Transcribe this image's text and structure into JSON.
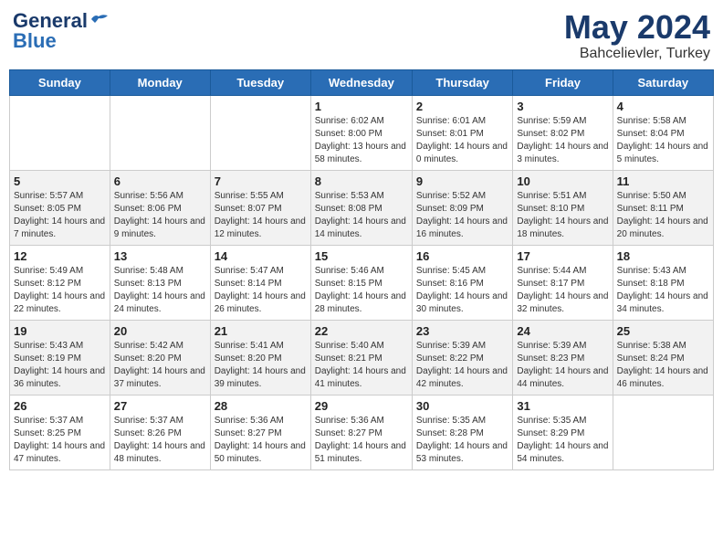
{
  "header": {
    "logo_general": "General",
    "logo_blue": "Blue",
    "month": "May 2024",
    "location": "Bahcelievler, Turkey"
  },
  "weekdays": [
    "Sunday",
    "Monday",
    "Tuesday",
    "Wednesday",
    "Thursday",
    "Friday",
    "Saturday"
  ],
  "weeks": [
    [
      {
        "day": "",
        "sunrise": "",
        "sunset": "",
        "daylight": ""
      },
      {
        "day": "",
        "sunrise": "",
        "sunset": "",
        "daylight": ""
      },
      {
        "day": "",
        "sunrise": "",
        "sunset": "",
        "daylight": ""
      },
      {
        "day": "1",
        "sunrise": "Sunrise: 6:02 AM",
        "sunset": "Sunset: 8:00 PM",
        "daylight": "Daylight: 13 hours and 58 minutes."
      },
      {
        "day": "2",
        "sunrise": "Sunrise: 6:01 AM",
        "sunset": "Sunset: 8:01 PM",
        "daylight": "Daylight: 14 hours and 0 minutes."
      },
      {
        "day": "3",
        "sunrise": "Sunrise: 5:59 AM",
        "sunset": "Sunset: 8:02 PM",
        "daylight": "Daylight: 14 hours and 3 minutes."
      },
      {
        "day": "4",
        "sunrise": "Sunrise: 5:58 AM",
        "sunset": "Sunset: 8:04 PM",
        "daylight": "Daylight: 14 hours and 5 minutes."
      }
    ],
    [
      {
        "day": "5",
        "sunrise": "Sunrise: 5:57 AM",
        "sunset": "Sunset: 8:05 PM",
        "daylight": "Daylight: 14 hours and 7 minutes."
      },
      {
        "day": "6",
        "sunrise": "Sunrise: 5:56 AM",
        "sunset": "Sunset: 8:06 PM",
        "daylight": "Daylight: 14 hours and 9 minutes."
      },
      {
        "day": "7",
        "sunrise": "Sunrise: 5:55 AM",
        "sunset": "Sunset: 8:07 PM",
        "daylight": "Daylight: 14 hours and 12 minutes."
      },
      {
        "day": "8",
        "sunrise": "Sunrise: 5:53 AM",
        "sunset": "Sunset: 8:08 PM",
        "daylight": "Daylight: 14 hours and 14 minutes."
      },
      {
        "day": "9",
        "sunrise": "Sunrise: 5:52 AM",
        "sunset": "Sunset: 8:09 PM",
        "daylight": "Daylight: 14 hours and 16 minutes."
      },
      {
        "day": "10",
        "sunrise": "Sunrise: 5:51 AM",
        "sunset": "Sunset: 8:10 PM",
        "daylight": "Daylight: 14 hours and 18 minutes."
      },
      {
        "day": "11",
        "sunrise": "Sunrise: 5:50 AM",
        "sunset": "Sunset: 8:11 PM",
        "daylight": "Daylight: 14 hours and 20 minutes."
      }
    ],
    [
      {
        "day": "12",
        "sunrise": "Sunrise: 5:49 AM",
        "sunset": "Sunset: 8:12 PM",
        "daylight": "Daylight: 14 hours and 22 minutes."
      },
      {
        "day": "13",
        "sunrise": "Sunrise: 5:48 AM",
        "sunset": "Sunset: 8:13 PM",
        "daylight": "Daylight: 14 hours and 24 minutes."
      },
      {
        "day": "14",
        "sunrise": "Sunrise: 5:47 AM",
        "sunset": "Sunset: 8:14 PM",
        "daylight": "Daylight: 14 hours and 26 minutes."
      },
      {
        "day": "15",
        "sunrise": "Sunrise: 5:46 AM",
        "sunset": "Sunset: 8:15 PM",
        "daylight": "Daylight: 14 hours and 28 minutes."
      },
      {
        "day": "16",
        "sunrise": "Sunrise: 5:45 AM",
        "sunset": "Sunset: 8:16 PM",
        "daylight": "Daylight: 14 hours and 30 minutes."
      },
      {
        "day": "17",
        "sunrise": "Sunrise: 5:44 AM",
        "sunset": "Sunset: 8:17 PM",
        "daylight": "Daylight: 14 hours and 32 minutes."
      },
      {
        "day": "18",
        "sunrise": "Sunrise: 5:43 AM",
        "sunset": "Sunset: 8:18 PM",
        "daylight": "Daylight: 14 hours and 34 minutes."
      }
    ],
    [
      {
        "day": "19",
        "sunrise": "Sunrise: 5:43 AM",
        "sunset": "Sunset: 8:19 PM",
        "daylight": "Daylight: 14 hours and 36 minutes."
      },
      {
        "day": "20",
        "sunrise": "Sunrise: 5:42 AM",
        "sunset": "Sunset: 8:20 PM",
        "daylight": "Daylight: 14 hours and 37 minutes."
      },
      {
        "day": "21",
        "sunrise": "Sunrise: 5:41 AM",
        "sunset": "Sunset: 8:20 PM",
        "daylight": "Daylight: 14 hours and 39 minutes."
      },
      {
        "day": "22",
        "sunrise": "Sunrise: 5:40 AM",
        "sunset": "Sunset: 8:21 PM",
        "daylight": "Daylight: 14 hours and 41 minutes."
      },
      {
        "day": "23",
        "sunrise": "Sunrise: 5:39 AM",
        "sunset": "Sunset: 8:22 PM",
        "daylight": "Daylight: 14 hours and 42 minutes."
      },
      {
        "day": "24",
        "sunrise": "Sunrise: 5:39 AM",
        "sunset": "Sunset: 8:23 PM",
        "daylight": "Daylight: 14 hours and 44 minutes."
      },
      {
        "day": "25",
        "sunrise": "Sunrise: 5:38 AM",
        "sunset": "Sunset: 8:24 PM",
        "daylight": "Daylight: 14 hours and 46 minutes."
      }
    ],
    [
      {
        "day": "26",
        "sunrise": "Sunrise: 5:37 AM",
        "sunset": "Sunset: 8:25 PM",
        "daylight": "Daylight: 14 hours and 47 minutes."
      },
      {
        "day": "27",
        "sunrise": "Sunrise: 5:37 AM",
        "sunset": "Sunset: 8:26 PM",
        "daylight": "Daylight: 14 hours and 48 minutes."
      },
      {
        "day": "28",
        "sunrise": "Sunrise: 5:36 AM",
        "sunset": "Sunset: 8:27 PM",
        "daylight": "Daylight: 14 hours and 50 minutes."
      },
      {
        "day": "29",
        "sunrise": "Sunrise: 5:36 AM",
        "sunset": "Sunset: 8:27 PM",
        "daylight": "Daylight: 14 hours and 51 minutes."
      },
      {
        "day": "30",
        "sunrise": "Sunrise: 5:35 AM",
        "sunset": "Sunset: 8:28 PM",
        "daylight": "Daylight: 14 hours and 53 minutes."
      },
      {
        "day": "31",
        "sunrise": "Sunrise: 5:35 AM",
        "sunset": "Sunset: 8:29 PM",
        "daylight": "Daylight: 14 hours and 54 minutes."
      },
      {
        "day": "",
        "sunrise": "",
        "sunset": "",
        "daylight": ""
      }
    ]
  ]
}
